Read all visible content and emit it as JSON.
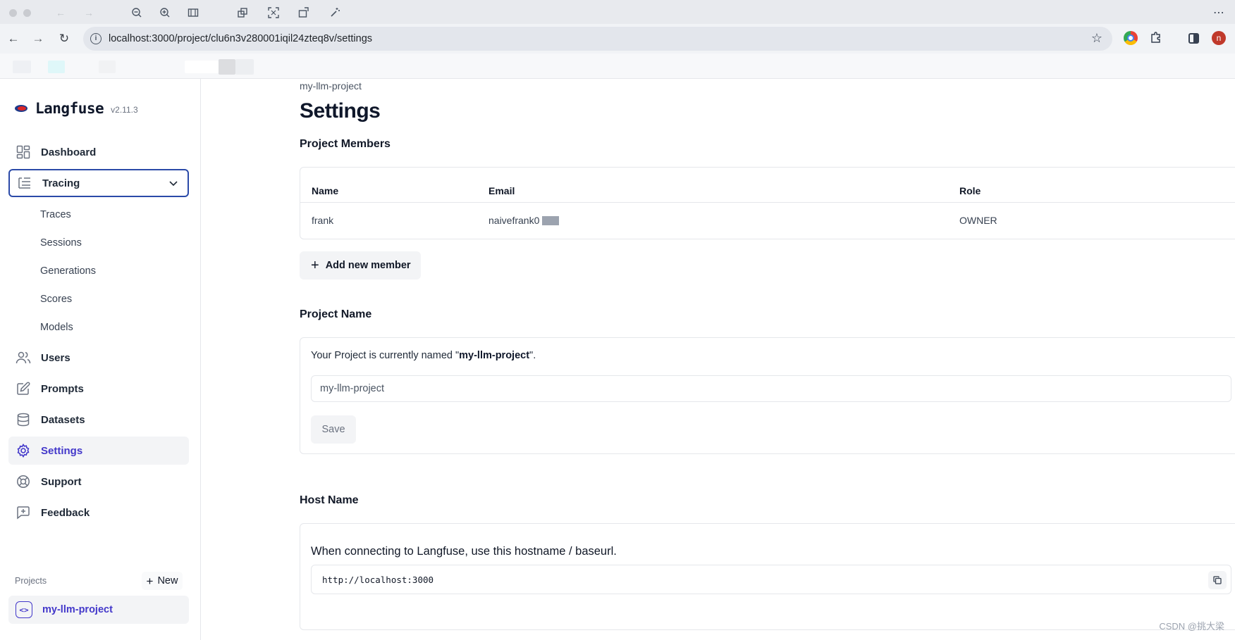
{
  "browser": {
    "url": "localhost:3000/project/clu6n3v280001iqil24zteq8v/settings",
    "profile_initial": "n"
  },
  "app": {
    "name": "Langfuse",
    "version": "v2.11.3"
  },
  "sidebar": {
    "items": [
      {
        "label": "Dashboard",
        "icon": "dashboard-icon"
      },
      {
        "label": "Tracing",
        "icon": "tracing-icon"
      },
      {
        "label": "Users",
        "icon": "users-icon"
      },
      {
        "label": "Prompts",
        "icon": "prompts-icon"
      },
      {
        "label": "Datasets",
        "icon": "datasets-icon"
      },
      {
        "label": "Settings",
        "icon": "gear-icon"
      },
      {
        "label": "Support",
        "icon": "support-icon"
      },
      {
        "label": "Feedback",
        "icon": "feedback-icon"
      }
    ],
    "tracing_sub": [
      "Traces",
      "Sessions",
      "Generations",
      "Scores",
      "Models"
    ],
    "projects_label": "Projects",
    "new_label": "New",
    "current_project": "my-llm-project"
  },
  "page": {
    "breadcrumb": "my-llm-project",
    "title": "Settings"
  },
  "members": {
    "title": "Project Members",
    "columns": [
      "Name",
      "Email",
      "Role"
    ],
    "rows": [
      {
        "name": "frank",
        "email": "naivefrank0",
        "role": "OWNER"
      }
    ],
    "add_label": "Add new member"
  },
  "project_name": {
    "title": "Project Name",
    "desc_prefix": "Your Project is currently named \"",
    "desc_name": "my-llm-project",
    "desc_suffix": "\".",
    "input_value": "my-llm-project",
    "save_label": "Save"
  },
  "host": {
    "title": "Host Name",
    "desc": "When connecting to Langfuse, use this hostname / baseurl.",
    "value": "http://localhost:3000"
  },
  "watermark": "CSDN @挑大梁"
}
